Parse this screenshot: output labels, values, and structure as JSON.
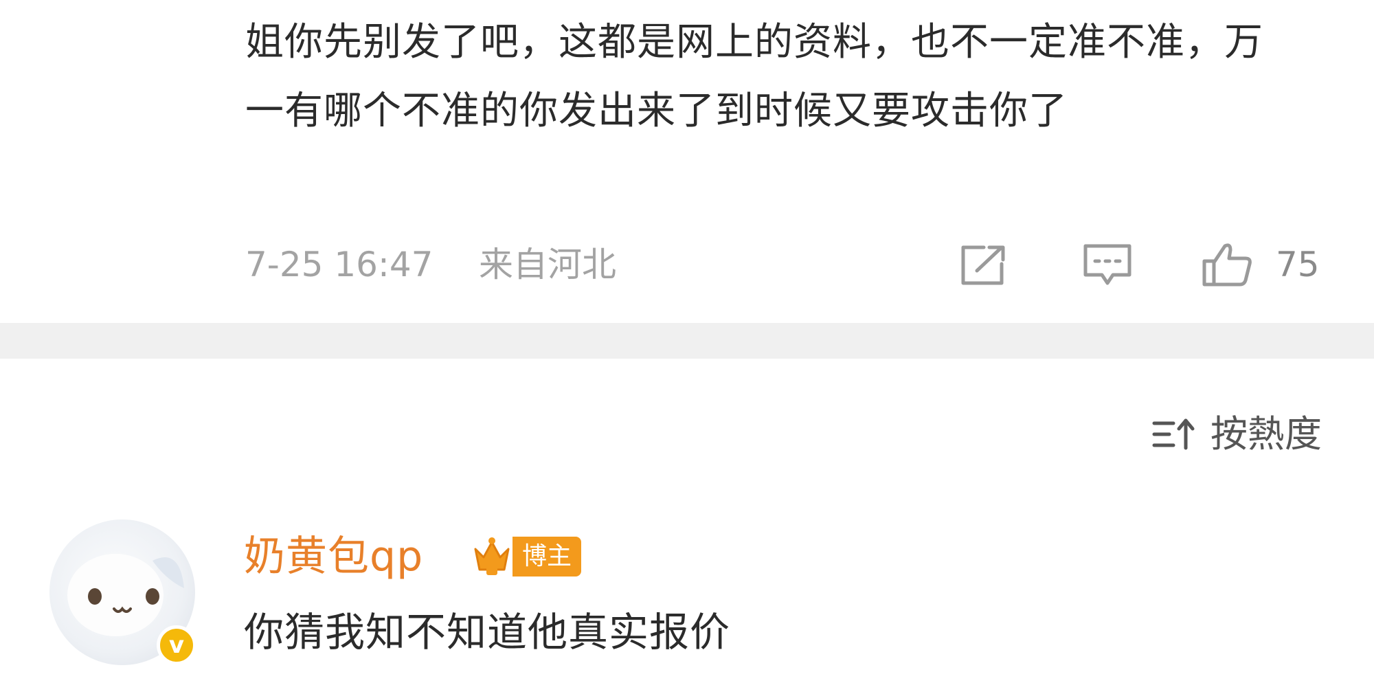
{
  "comment": {
    "text": "姐你先别发了吧，这都是网上的资料，也不一定准不准，万一有哪个不准的你发出来了到时候又要攻击你了",
    "timestamp": "7-25 16:47",
    "location": "来自河北",
    "like_count": "75",
    "icons": [
      "share-icon",
      "reply-icon",
      "like-icon"
    ]
  },
  "sort": {
    "icon": "sort-icon",
    "label": "按熱度"
  },
  "reply": {
    "username": "奶黄包qp",
    "badge_label": "博主",
    "badge_icon": "crown-icon",
    "verify_mark": "v",
    "text": "你猜我知不知道他真实报价"
  },
  "colors": {
    "username": "#e8802a",
    "badge": "#f39a1c",
    "verify": "#f5b90a",
    "meta": "#a3a3a3",
    "divider": "#f0f0f0"
  }
}
